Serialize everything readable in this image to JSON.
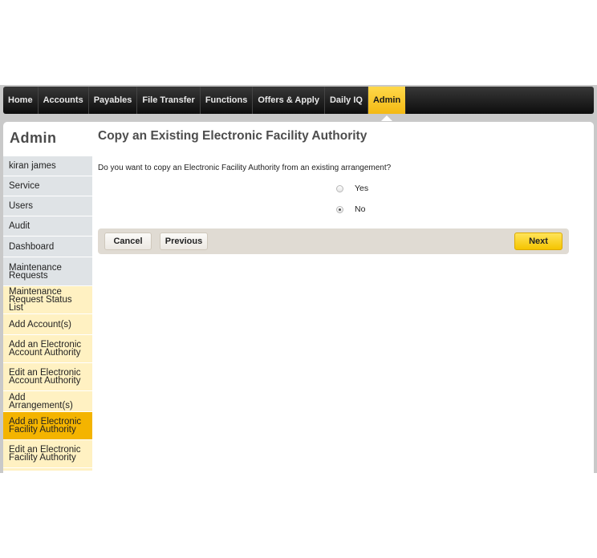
{
  "topnav": {
    "items": [
      {
        "label": "Home"
      },
      {
        "label": "Accounts"
      },
      {
        "label": "Payables"
      },
      {
        "label": "File Transfer"
      },
      {
        "label": "Functions"
      },
      {
        "label": "Offers & Apply"
      },
      {
        "label": "Daily IQ"
      },
      {
        "label": "Admin",
        "active": true
      }
    ]
  },
  "sidebar": {
    "title": "Admin",
    "items": [
      {
        "label": "kiran james",
        "style": "grey"
      },
      {
        "label": "Service",
        "style": "grey"
      },
      {
        "label": "Users",
        "style": "grey"
      },
      {
        "label": "Audit",
        "style": "grey"
      },
      {
        "label": "Dashboard",
        "style": "grey"
      },
      {
        "label": "Maintenance Requests",
        "style": "grey"
      },
      {
        "label": "Maintenance Request Status List",
        "style": "yellow"
      },
      {
        "label": "Add Account(s)",
        "style": "yellow"
      },
      {
        "label": "Add an Electronic Account Authority",
        "style": "yellow"
      },
      {
        "label": "Edit an Electronic Account Authority",
        "style": "yellow"
      },
      {
        "label": "Add Arrangement(s)",
        "style": "yellow"
      },
      {
        "label": "Add an Electronic Facility Authority",
        "style": "active"
      },
      {
        "label": "Edit an Electronic Facility Authority",
        "style": "yellow"
      }
    ]
  },
  "main": {
    "title": "Copy an Existing Electronic Facility Authority",
    "question": "Do you want to copy an Electronic Facility Authority from an existing arrangement?",
    "options": [
      {
        "label": "Yes",
        "checked": false
      },
      {
        "label": "No",
        "checked": true
      }
    ],
    "buttons": {
      "cancel": "Cancel",
      "previous": "Previous",
      "next": "Next"
    }
  },
  "colors": {
    "nav_active": "#f8c52a",
    "sidebar_active": "#f4b400",
    "sidebar_yellow": "#fff1c2",
    "sidebar_grey": "#dfe3e6",
    "action_bar": "#e0dbd3"
  }
}
